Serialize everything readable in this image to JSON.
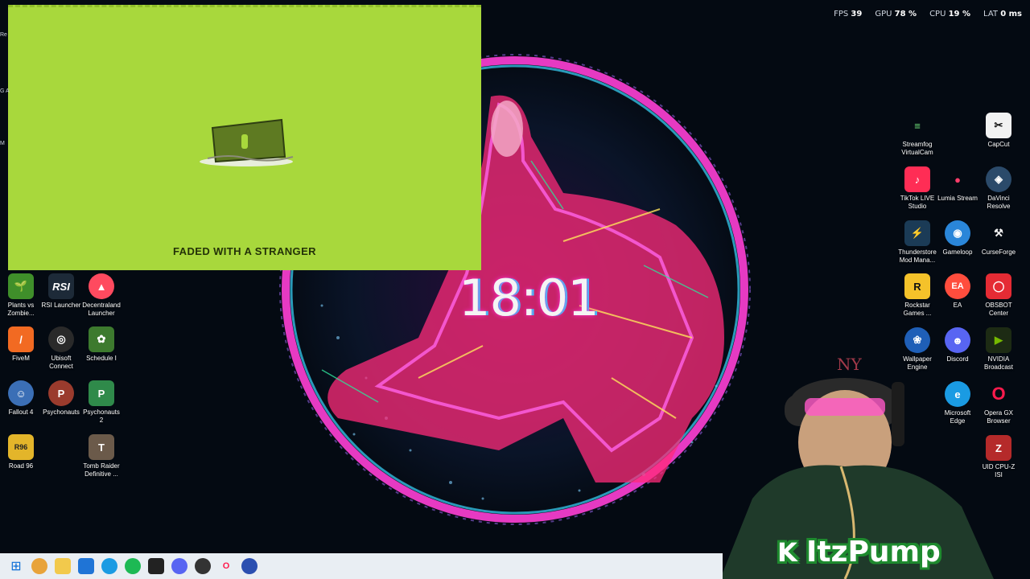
{
  "perf": {
    "fps_label": "FPS",
    "fps": "39",
    "gpu_label": "GPU",
    "gpu": "78 %",
    "cpu_label": "CPU",
    "cpu": "19 %",
    "lat_label": "LAT",
    "lat": "0 ms"
  },
  "player": {
    "track": "FADED WITH A STRANGER"
  },
  "clock": "18:01",
  "brand": "ItzPump",
  "left_icons": {
    "plants": "Plants vs Zombie...",
    "rsi": "RSI Launcher",
    "decentraland": "Decentraland Launcher",
    "fivem": "FiveM",
    "ubisoft": "Ubisoft Connect",
    "schedule": "Schedule I",
    "fallout": "Fallout 4",
    "psychonauts": "Psychonauts",
    "psychonauts2": "Psychonauts 2",
    "road96": "Road 96",
    "tombraider": "Tomb Raider Definitive ..."
  },
  "right_icons": {
    "streamfog": "Streamfog VirtualCam",
    "capcut": "CapCut",
    "tiktok": "TikTok LIVE Studio",
    "lumia": "Lumia Stream",
    "davinci": "DaVinci Resolve",
    "thunderstore": "Thunderstore Mod Mana...",
    "gameloop": "Gameloop",
    "curseforge": "CurseForge",
    "rockstar": "Rockstar Games ...",
    "ea": "EA",
    "obsbot": "OBSBOT Center",
    "wallpaper": "Wallpaper Engine",
    "discord": "Discord",
    "nvidia": "NVIDIA Broadcast",
    "edge": "Microsoft Edge",
    "opera": "Opera GX Browser",
    "cpuz": "UID CPU-Z ISI"
  },
  "colors": {
    "player_bg": "#a8d83c",
    "wallpaper_bg": "#040a12",
    "brand_outline": "#1e8a2e"
  },
  "taskbar_icons": [
    "windows-icon",
    "copilot-icon",
    "file-explorer-icon",
    "store-icon",
    "edge-icon",
    "spotify-icon",
    "terminal-icon",
    "discord-icon",
    "obs-icon",
    "opera-icon",
    "browser-icon"
  ]
}
